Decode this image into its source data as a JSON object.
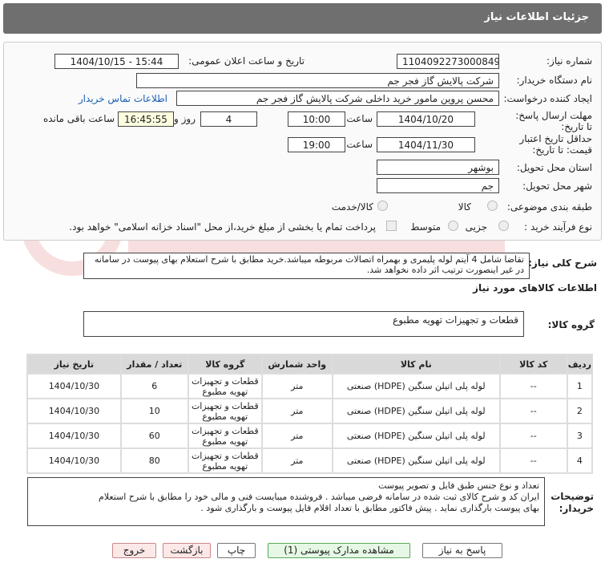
{
  "header": {
    "title": "جزئیات اطلاعات نیاز"
  },
  "form": {
    "need_number_label": "شماره نیاز:",
    "need_number": "1104092273000849",
    "announce_label": "تاریخ و ساعت اعلان عمومی:",
    "announce_value": "1404/10/15 - 15:44",
    "buyer_org_label": "نام دستگاه خریدار:",
    "buyer_org": "شرکت پالایش گاز فجر جم",
    "creator_label": "ایجاد کننده درخواست:",
    "creator": "محسن پروین مامور خرید داخلی شرکت پالایش گاز فجر جم",
    "contact_link": "اطلاعات تماس خریدار",
    "send_deadline_label": "مهلت ارسال پاسخ: تا تاریخ:",
    "send_date": "1404/10/20",
    "hour_label": "ساعت",
    "send_time": "10:00",
    "days_value": "4",
    "days_label": "روز و",
    "remaining_time": "16:45:55",
    "remaining_label": "ساعت باقی مانده",
    "validity_label": "حداقل تاریخ اعتبار قیمت: تا تاریخ:",
    "validity_date": "1404/11/30",
    "validity_time": "19:00",
    "province_label": "استان محل تحویل:",
    "province": "بوشهر",
    "city_label": "شهر محل تحویل:",
    "city": "جم",
    "category_label": "طبقه بندی موضوعی:",
    "category_options": [
      "کالا",
      "کالا/خدمت"
    ],
    "process_label": "نوع فرآیند خرید :",
    "process_options": [
      "جزیی",
      "متوسط"
    ],
    "payment_note": "پرداخت تمام یا بخشی از مبلغ خرید،از محل \"اسناد خزانه اسلامی\" خواهد بود."
  },
  "summary": {
    "label": "شرح کلی نیاز:",
    "text": "تقاضا  شامل 4 آیتم لوله پلیمری و بهمراه اتصالات مربوطه میباشد.خرید مطابق با شرح استعلام بهای پیوست در سامانه در غیر اینصورت ترتیب اثر داده نخواهد شد."
  },
  "goods_info_label": "اطلاعات کالاهای مورد نیاز",
  "goods_group": {
    "label": "گروه کالا:",
    "value": "قطعات و تجهیزات تهویه مطبوع"
  },
  "table": {
    "headers": [
      "ردیف",
      "کد کالا",
      "نام کالا",
      "واحد شمارش",
      "گروه کالا",
      "تعداد / مقدار",
      "تاریخ نیاز"
    ],
    "rows": [
      [
        "1",
        "--",
        "لوله پلی اتیلن سنگین (HDPE) صنعتی",
        "متر",
        "قطعات و تجهیزات تهویه مطبوع",
        "6",
        "1404/10/30"
      ],
      [
        "2",
        "--",
        "لوله پلی اتیلن سنگین (HDPE) صنعتی",
        "متر",
        "قطعات و تجهیزات تهویه مطبوع",
        "10",
        "1404/10/30"
      ],
      [
        "3",
        "--",
        "لوله پلی اتیلن سنگین (HDPE) صنعتی",
        "متر",
        "قطعات و تجهیزات تهویه مطبوع",
        "60",
        "1404/10/30"
      ],
      [
        "4",
        "--",
        "لوله پلی اتیلن سنگین (HDPE) صنعتی",
        "متر",
        "قطعات و تجهیزات تهویه مطبوع",
        "80",
        "1404/10/30"
      ]
    ]
  },
  "buyer_notes": {
    "label": "توضیحات خریدار:",
    "lines": [
      "تعداد و نوع جنس طبق فایل و تصویر پیوست",
      "ایران کد و شرح کالای ثبت شده در سامانه فرضی میباشد . فروشنده میبایست فنی و مالی خود را مطابق با شرح استعلام",
      "بهای پیوست بارگذاری نماید . پیش فاکتور مطابق با تعداد اقلام فایل پیوست و بارگذاری شود ."
    ]
  },
  "buttons": {
    "reply": "پاسخ به نیاز",
    "view_docs": "مشاهده مدارک پیوستی (1)",
    "print": "چاپ",
    "back": "بازگشت",
    "exit": "خروج"
  }
}
